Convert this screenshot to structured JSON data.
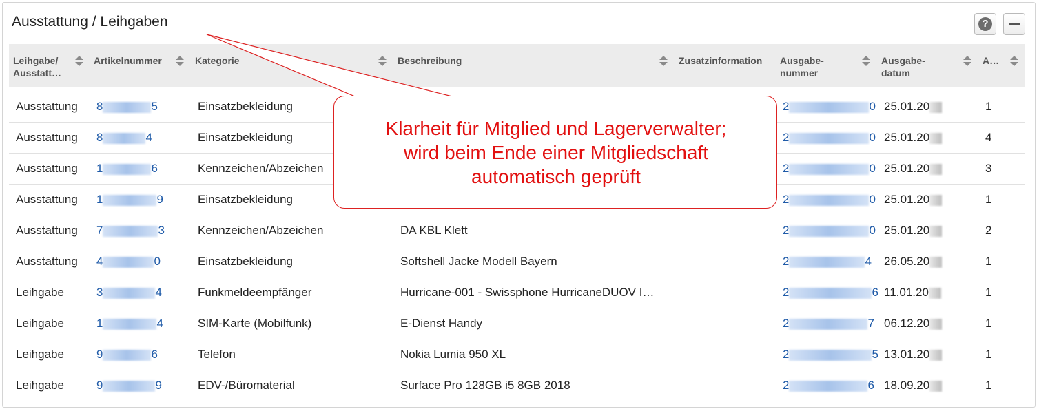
{
  "panel": {
    "title": "Ausstattung / Leihgaben",
    "help_label": "?"
  },
  "columns": [
    {
      "label": "Leihgabe/\nAusstatt…"
    },
    {
      "label": "Artikelnummer"
    },
    {
      "label": "Kategorie"
    },
    {
      "label": "Beschreibung"
    },
    {
      "label": "Zusatzinformation"
    },
    {
      "label": "Ausgabe-\nnummer"
    },
    {
      "label": "Ausgabe-\ndatum"
    },
    {
      "label": "A…"
    }
  ],
  "rows": [
    {
      "type": "Ausstattung",
      "art_first": "8",
      "art_last": "5",
      "category": "Einsatzbekleidung",
      "description": "",
      "extra": "",
      "issue_first": "2",
      "issue_last": "0",
      "date": "25.01.20",
      "qty": "1"
    },
    {
      "type": "Ausstattung",
      "art_first": "8",
      "art_last": "4",
      "category": "Einsatzbekleidung",
      "description": "",
      "extra": "",
      "issue_first": "2",
      "issue_last": "0",
      "date": "25.01.20",
      "qty": "4"
    },
    {
      "type": "Ausstattung",
      "art_first": "1",
      "art_last": "6",
      "category": "Kennzeichen/Abzeichen",
      "description": "",
      "extra": "",
      "issue_first": "2",
      "issue_last": "0",
      "date": "25.01.20",
      "qty": "3"
    },
    {
      "type": "Ausstattung",
      "art_first": "1",
      "art_last": "9",
      "category": "Einsatzbekleidung",
      "description": "",
      "extra": "",
      "issue_first": "2",
      "issue_last": "0",
      "date": "25.01.20",
      "qty": "1"
    },
    {
      "type": "Ausstattung",
      "art_first": "7",
      "art_last": "3",
      "category": "Kennzeichen/Abzeichen",
      "description": "DA KBL Klett",
      "extra": "",
      "issue_first": "2",
      "issue_last": "0",
      "date": "25.01.20",
      "qty": "2"
    },
    {
      "type": "Ausstattung",
      "art_first": "4",
      "art_last": "0",
      "category": "Einsatzbekleidung",
      "description": "Softshell Jacke Modell Bayern",
      "extra": "",
      "issue_first": "2",
      "issue_last": "4",
      "date": "26.05.20",
      "qty": "1"
    },
    {
      "type": "Leihgabe",
      "art_first": "3",
      "art_last": "4",
      "category": "Funkmeldeempfänger",
      "description": "Hurricane-001 - Swissphone HurricaneDUOV I…",
      "extra": "",
      "issue_first": "2",
      "issue_last": "6",
      "date": "11.01.20",
      "qty": "1"
    },
    {
      "type": "Leihgabe",
      "art_first": "1",
      "art_last": "4",
      "category": "SIM-Karte (Mobilfunk)",
      "description": "E-Dienst Handy",
      "extra": "",
      "issue_first": "2",
      "issue_last": "7",
      "date": "06.12.20",
      "qty": "1"
    },
    {
      "type": "Leihgabe",
      "art_first": "9",
      "art_last": "6",
      "category": "Telefon",
      "description": "Nokia Lumia 950 XL",
      "extra": "",
      "issue_first": "2",
      "issue_last": "5",
      "date": "13.01.20",
      "qty": "1"
    },
    {
      "type": "Leihgabe",
      "art_first": "9",
      "art_last": "9",
      "category": "EDV-/Büromaterial",
      "description": "Surface Pro 128GB i5 8GB 2018",
      "extra": "",
      "issue_first": "2",
      "issue_last": "6",
      "date": "18.09.20",
      "qty": "1"
    }
  ],
  "callout": {
    "line1": "Klarheit für Mitglied und Lagerverwalter;",
    "line2": "wird beim Ende einer Mitgliedschaft",
    "line3": "automatisch geprüft"
  },
  "colors": {
    "link": "#1e5aa8",
    "callout": "#e21010",
    "header_bg": "#ececec"
  }
}
